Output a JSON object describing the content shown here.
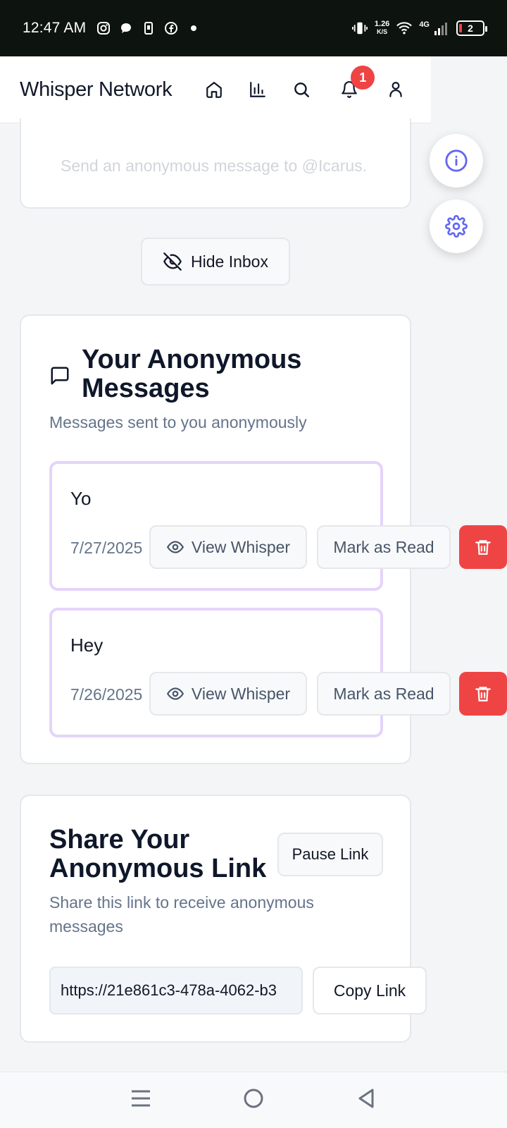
{
  "status_bar": {
    "time": "12:47 AM",
    "speed_value": "1.26",
    "speed_unit": "K/S",
    "network": "4G",
    "battery": "2"
  },
  "header": {
    "title": "Whisper Network",
    "notification_count": "1"
  },
  "compose": {
    "placeholder": "Send an anonymous message to @Icarus."
  },
  "hide_inbox_label": "Hide Inbox",
  "inbox": {
    "title": "Your Anonymous Messages",
    "subtitle": "Messages sent to you anonymously",
    "messages": [
      {
        "text": "Yo",
        "date": "7/27/2025",
        "view_label": "View Whisper",
        "mark_label": "Mark as Read"
      },
      {
        "text": "Hey",
        "date": "7/26/2025",
        "view_label": "View Whisper",
        "mark_label": "Mark as Read"
      }
    ]
  },
  "share": {
    "title": "Share Your Anonymous Link",
    "pause_label": "Pause Link",
    "subtitle": "Share this link to receive anonymous messages",
    "link": "https://21e861c3-478a-4062-b3",
    "copy_label": "Copy Link"
  },
  "colors": {
    "accent": "#6366f1",
    "danger": "#ef4444",
    "message_border": "#e4d4fb"
  },
  "icons": [
    "home-icon",
    "chart-icon",
    "search-icon",
    "bell-icon",
    "user-icon",
    "info-icon",
    "settings-icon",
    "eye-off-icon",
    "message-icon",
    "eye-icon",
    "trash-icon"
  ]
}
